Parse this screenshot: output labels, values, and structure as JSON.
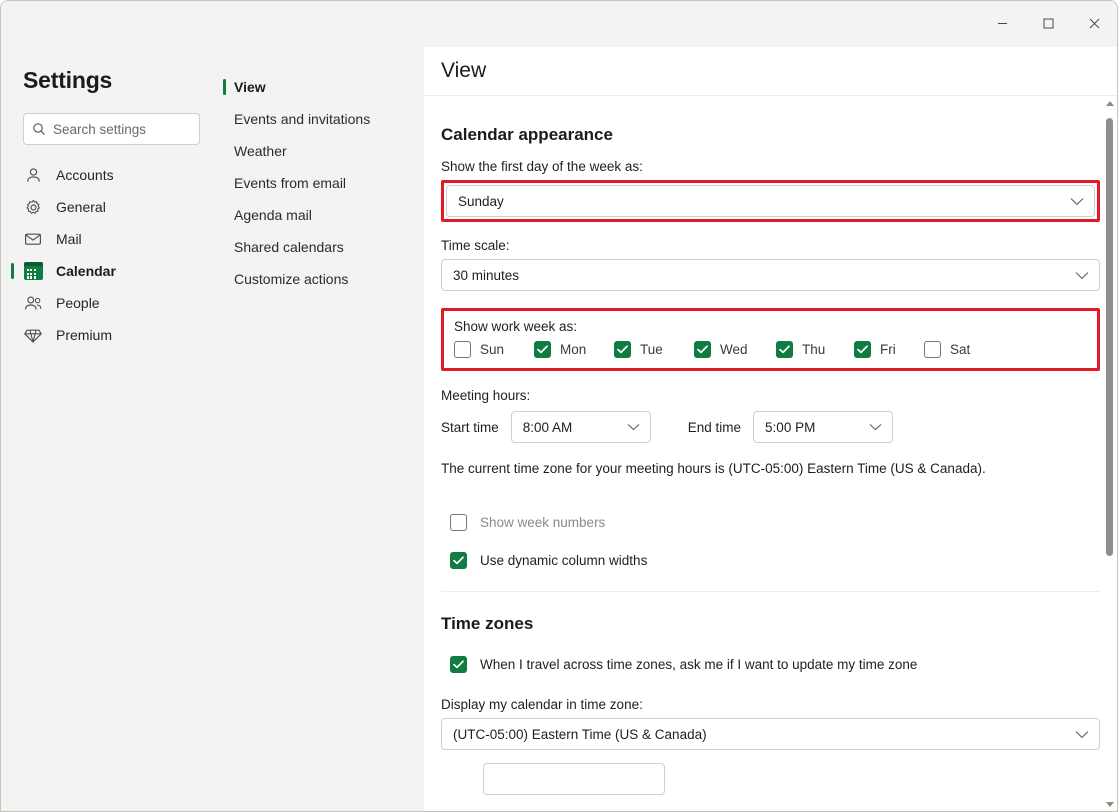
{
  "window": {
    "controls": [
      {
        "name": "minimize",
        "label": "Minimize"
      },
      {
        "name": "maximize",
        "label": "Maximize"
      },
      {
        "name": "close",
        "label": "Close"
      }
    ]
  },
  "sidebar": {
    "title": "Settings",
    "search": {
      "placeholder": "Search settings",
      "value": "",
      "icon": "search-icon"
    },
    "items": [
      {
        "label": "Accounts",
        "icon": "person-icon",
        "active": false
      },
      {
        "label": "General",
        "icon": "gear-icon",
        "active": false
      },
      {
        "label": "Mail",
        "icon": "envelope-icon",
        "active": false
      },
      {
        "label": "Calendar",
        "icon": "calendar-icon",
        "active": true
      },
      {
        "label": "People",
        "icon": "people-icon",
        "active": false
      },
      {
        "label": "Premium",
        "icon": "diamond-icon",
        "active": false
      }
    ]
  },
  "subnav": {
    "items": [
      {
        "label": "View",
        "active": true
      },
      {
        "label": "Events and invitations",
        "active": false
      },
      {
        "label": "Weather",
        "active": false
      },
      {
        "label": "Events from email",
        "active": false
      },
      {
        "label": "Agenda mail",
        "active": false
      },
      {
        "label": "Shared calendars",
        "active": false
      },
      {
        "label": "Customize actions",
        "active": false
      }
    ]
  },
  "main": {
    "header_title": "View",
    "calendar_appearance": {
      "section_title": "Calendar appearance",
      "first_day_label": "Show the first day of the week as:",
      "first_day_value": "Sunday",
      "time_scale_label": "Time scale:",
      "time_scale_value": "30 minutes",
      "work_week_label": "Show work week as:",
      "work_week_days": [
        {
          "label": "Sun",
          "checked": false
        },
        {
          "label": "Mon",
          "checked": true
        },
        {
          "label": "Tue",
          "checked": true
        },
        {
          "label": "Wed",
          "checked": true
        },
        {
          "label": "Thu",
          "checked": true
        },
        {
          "label": "Fri",
          "checked": true
        },
        {
          "label": "Sat",
          "checked": false
        }
      ],
      "meeting_hours_label": "Meeting hours:",
      "start_time_label": "Start time",
      "start_time_value": "8:00 AM",
      "end_time_label": "End time",
      "end_time_value": "5:00 PM",
      "timezone_note": "The current time zone for your meeting hours is (UTC-05:00) Eastern Time (US & Canada).",
      "options": [
        {
          "label": "Show week numbers",
          "checked": false,
          "disabled": true
        },
        {
          "label": "Use dynamic column widths",
          "checked": true,
          "disabled": false
        }
      ]
    },
    "time_zones": {
      "section_title": "Time zones",
      "travel_option": {
        "label": "When I travel across time zones, ask me if I want to update my time zone",
        "checked": true
      },
      "display_label": "Display my calendar in time zone:",
      "display_value": "(UTC-05:00) Eastern Time (US & Canada)"
    }
  },
  "highlights": {
    "color": "#e01b24",
    "regions": [
      "first-day-of-week-dropdown",
      "show-work-week-group"
    ]
  },
  "colors": {
    "accent_green": "#107c41",
    "sidebar_bg": "#f3f3f3",
    "content_bg": "#ffffff",
    "highlight_red": "#e01b24"
  },
  "scrollbar": {
    "orientation": "vertical",
    "thumb_top_pct": 3,
    "thumb_height_pct": 57
  }
}
